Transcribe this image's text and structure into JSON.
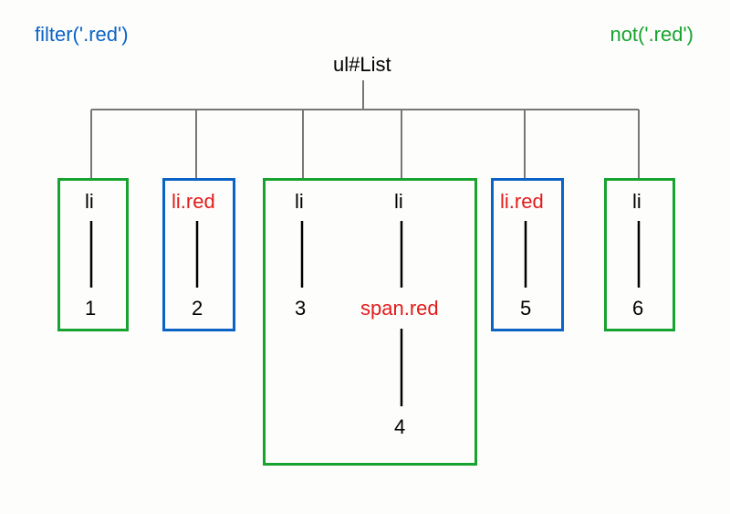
{
  "title_left": "filter('.red')",
  "title_right": "not('.red')",
  "root": "ul#List",
  "nodes": {
    "n1": {
      "label": "li",
      "value": "1"
    },
    "n2": {
      "label": "li.red",
      "value": "2"
    },
    "n3": {
      "label": "li",
      "value": "3"
    },
    "n4": {
      "label": "li",
      "child_label": "span.red",
      "value": "4"
    },
    "n5": {
      "label": "li.red",
      "value": "5"
    },
    "n6": {
      "label": "li",
      "value": "6"
    }
  }
}
